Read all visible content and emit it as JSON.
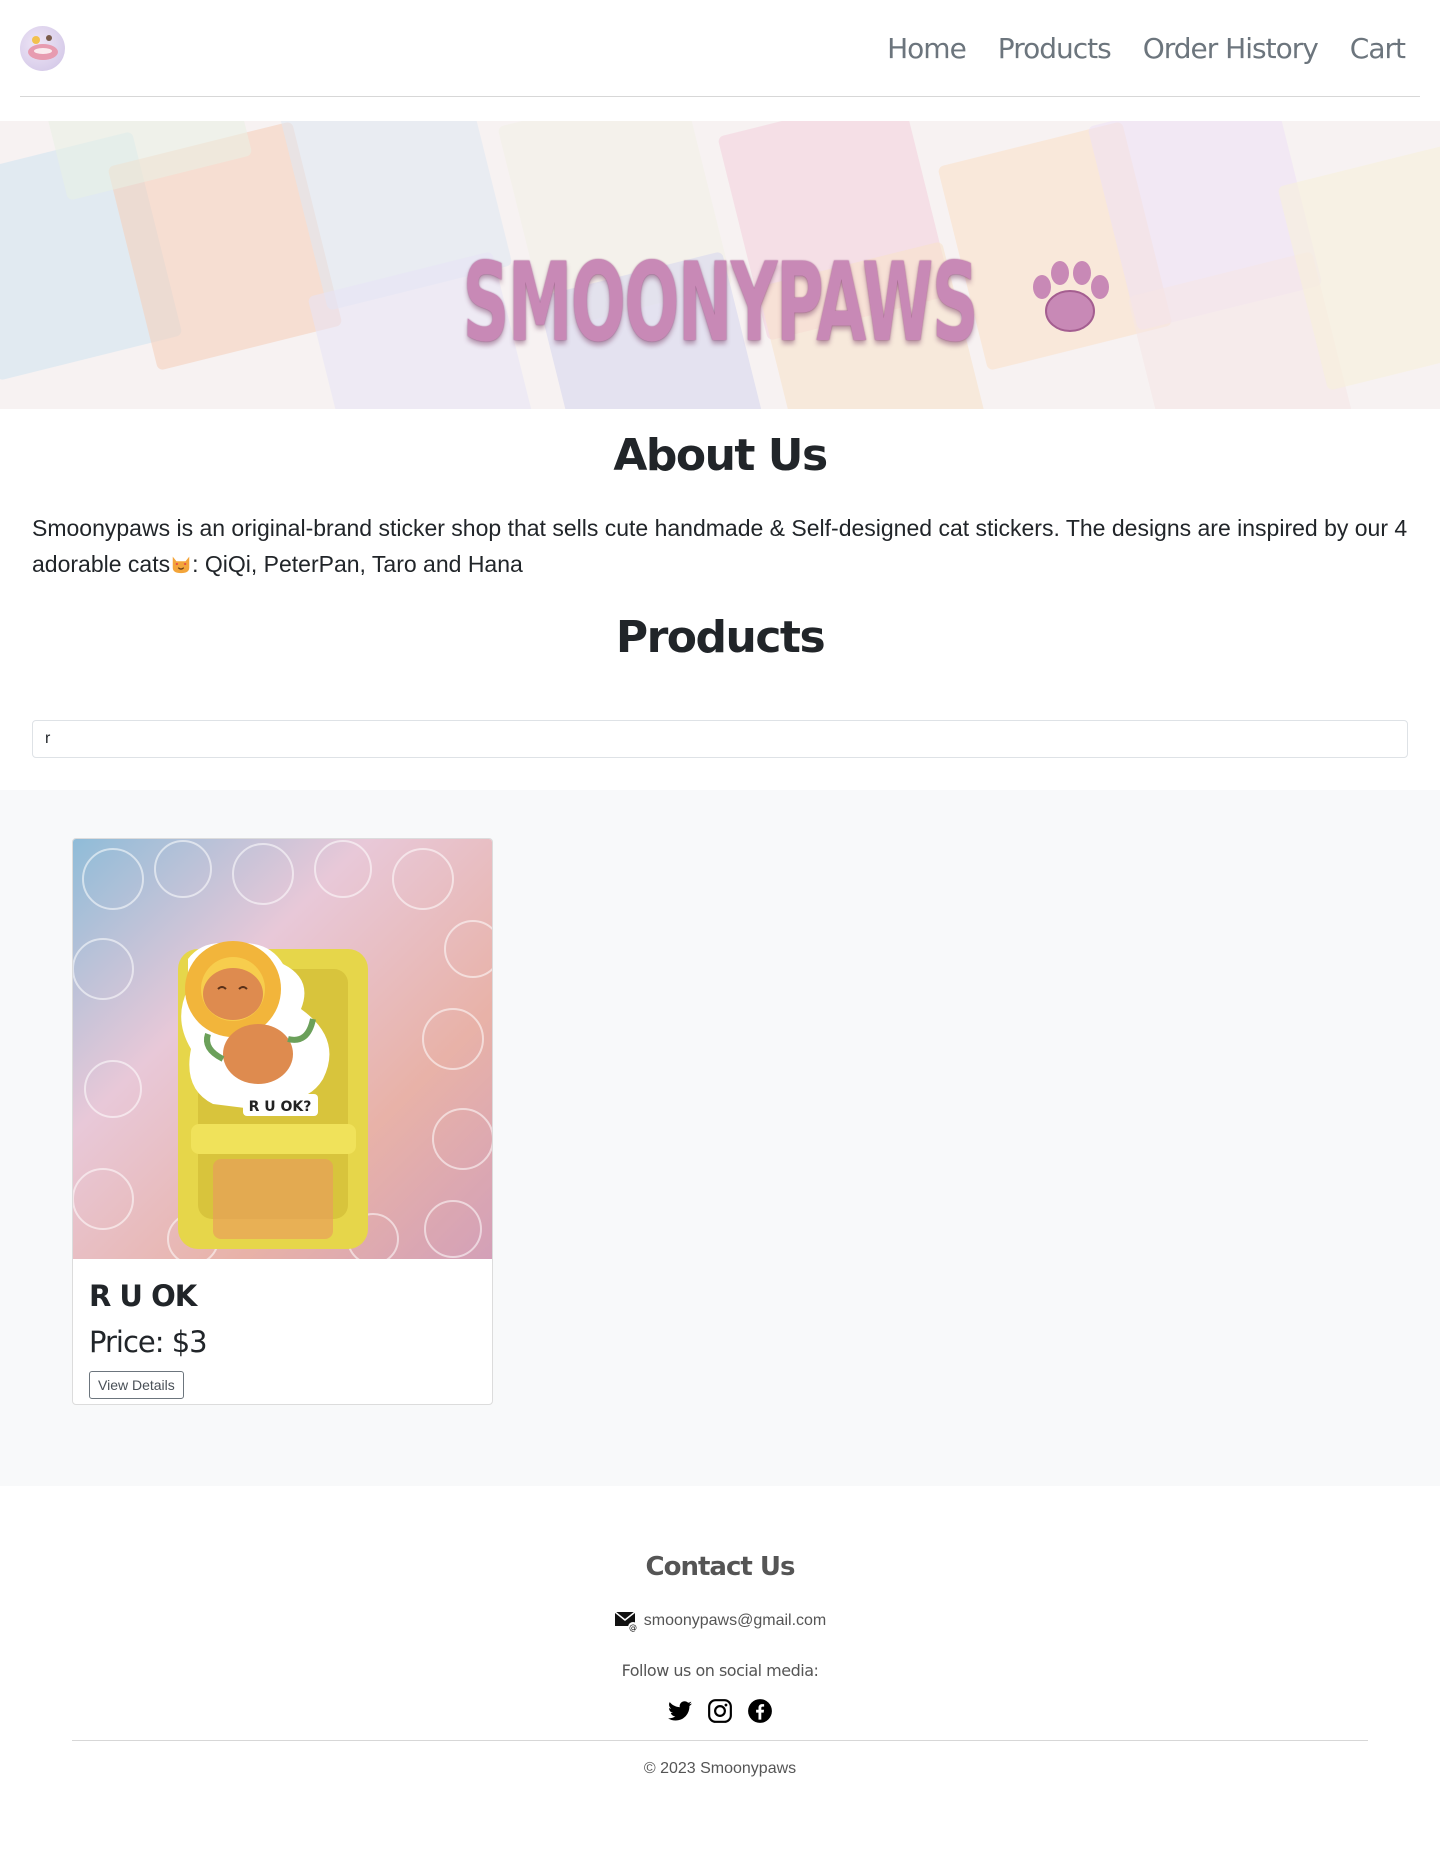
{
  "nav": {
    "logo_icon": "smoonypaws-logo",
    "links": [
      "Home",
      "Products",
      "Order History",
      "Cart"
    ]
  },
  "hero": {
    "title": "SMOONYPAWS",
    "paw_icon": "paw-icon"
  },
  "about": {
    "title": "About Us",
    "text_before": "Smoonypaws is an original-brand sticker shop that sells cute handmade & Self-designed cat stickers. The designs are inspired by our 4 adorable cats",
    "emoji_icon": "cat-heart-eyes-emoji",
    "text_after": ": QiQi, PeterPan, Taro and Hana"
  },
  "products": {
    "title": "Products",
    "search_value": "r",
    "items": [
      {
        "title": "R U OK",
        "price_label": "Price: $3",
        "button_label": "View Details",
        "image_caption": "R U OK?"
      }
    ]
  },
  "footer": {
    "contact_title": "Contact Us",
    "email_icon": "email-icon",
    "email": "smoonypaws@gmail.com",
    "follow_text": "Follow us on social media:",
    "social_icons": [
      "twitter-icon",
      "instagram-icon",
      "facebook-icon"
    ],
    "copyright": "© 2023 Smoonypaws"
  },
  "colors": {
    "brand_pink": "#c889b6",
    "nav_text": "#6c757d",
    "section_bg": "#f8f9fa"
  }
}
